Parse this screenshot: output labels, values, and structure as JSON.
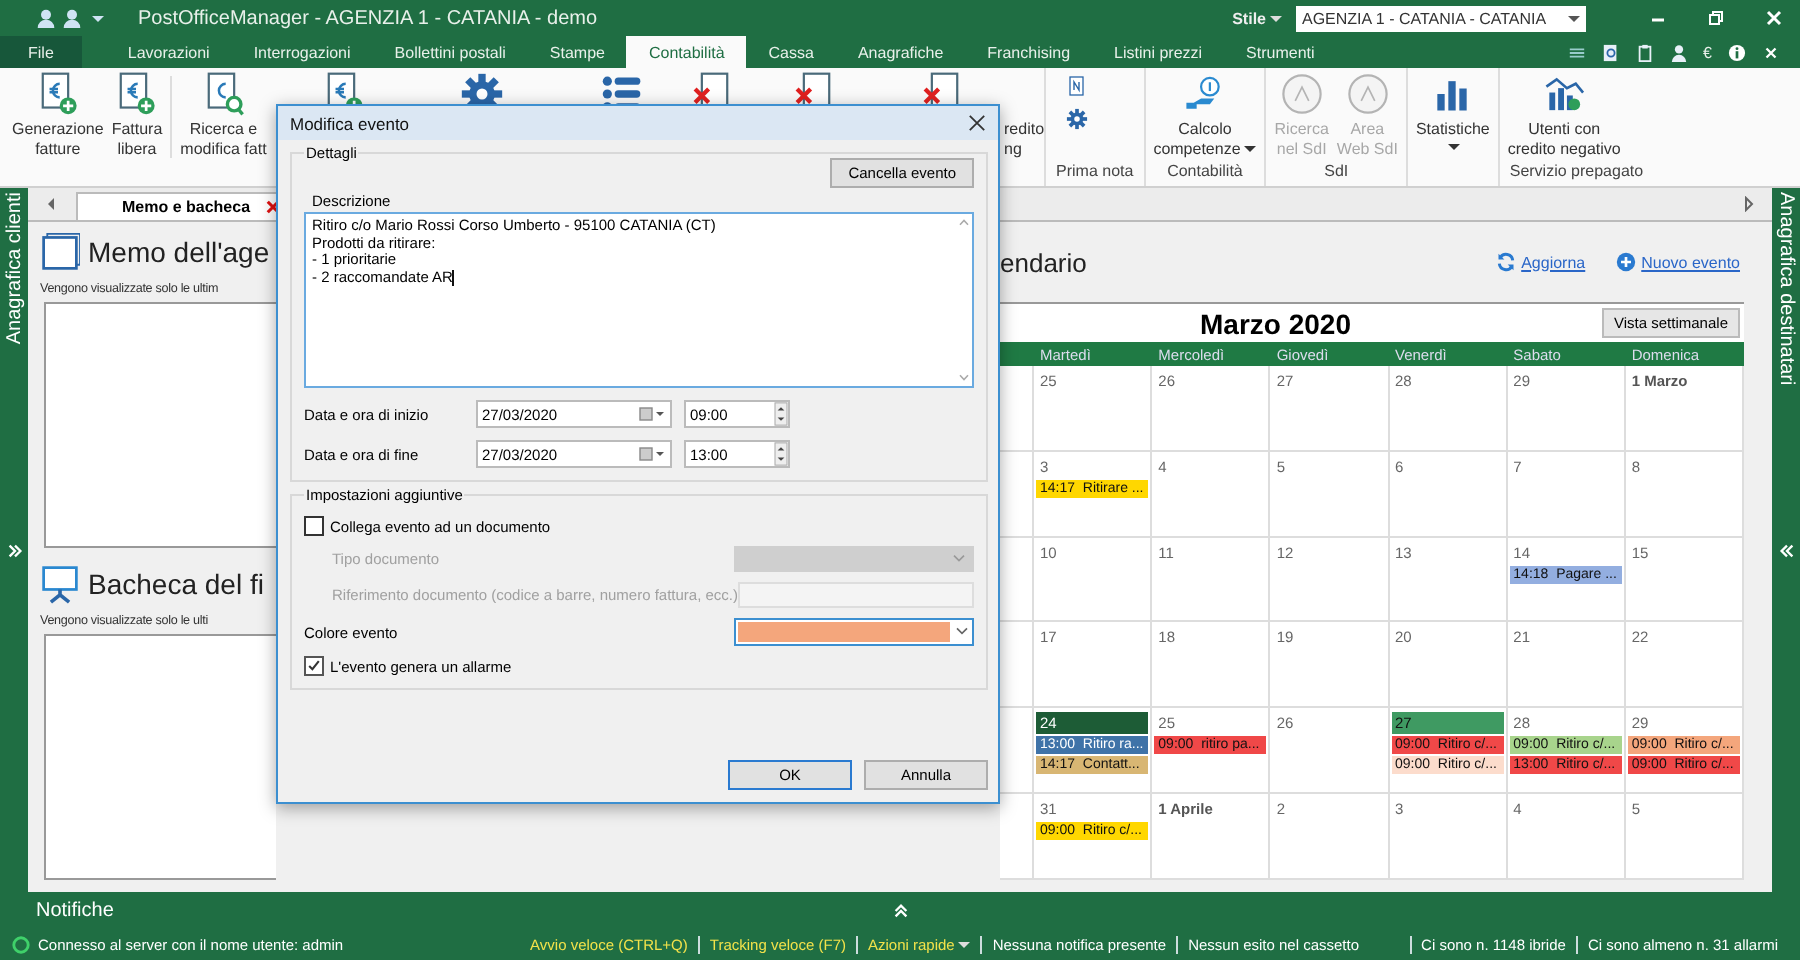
{
  "window": {
    "title": "PostOfficeManager - AGENZIA 1 - CATANIA - demo",
    "style_label": "Stile",
    "agency": "AGENZIA 1 - CATANIA - CATANIA"
  },
  "menu": [
    {
      "label": "File",
      "kind": "file",
      "selected": false
    },
    {
      "label": "Lavorazioni",
      "kind": "tab",
      "selected": false
    },
    {
      "label": "Interrogazioni",
      "kind": "tab",
      "selected": false
    },
    {
      "label": "Bollettini postali",
      "kind": "tab",
      "selected": false
    },
    {
      "label": "Stampe",
      "kind": "tab",
      "selected": false
    },
    {
      "label": "Contabilità",
      "kind": "tab",
      "selected": true
    },
    {
      "label": "Cassa",
      "kind": "tab",
      "selected": false
    },
    {
      "label": "Anagrafiche",
      "kind": "tab",
      "selected": false
    },
    {
      "label": "Franchising",
      "kind": "tab",
      "selected": false
    },
    {
      "label": "Listini prezzi",
      "kind": "tab",
      "selected": false
    },
    {
      "label": "Strumenti",
      "kind": "tab",
      "selected": false
    }
  ],
  "tray": {
    "currency": "€"
  },
  "ribbon": {
    "left_buttons": [
      {
        "lines": [
          "Generazione",
          "fatture"
        ]
      },
      {
        "lines": [
          "Fattura",
          "libera"
        ]
      },
      {
        "lines": [
          "Ricerca e",
          "modifica fatt"
        ]
      }
    ],
    "cut_label": [
      "redito",
      "ng"
    ],
    "groups": [
      {
        "label": "Prima nota"
      },
      {
        "label": "Contabilità",
        "buttons": [
          {
            "lines": [
              "Calcolo",
              "competenze"
            ],
            "dropdown": true
          }
        ]
      },
      {
        "label": "SdI",
        "buttons": [
          {
            "lines": [
              "Ricerca",
              "nel SdI"
            ],
            "disabled": true
          },
          {
            "lines": [
              "Area",
              "Web SdI"
            ],
            "disabled": true
          }
        ]
      },
      {
        "buttons": [
          {
            "lines": [
              "Statistiche"
            ],
            "dropdown": true
          }
        ]
      },
      {
        "label": "Servizio prepagato",
        "buttons": [
          {
            "lines": [
              "Utenti con",
              "credito negativo"
            ]
          }
        ]
      }
    ]
  },
  "sidebars": {
    "left": "Anagrafica clienti",
    "right": "Anagrafica destinatari"
  },
  "doc_tab": {
    "label": "Memo e bacheca",
    "selected": true
  },
  "memo": {
    "title": "Memo dell'age",
    "subtitle": "Vengono visualizzate solo le ultim"
  },
  "board": {
    "title": "Bacheca del fi",
    "subtitle": "Vengono visualizzate solo le ulti"
  },
  "calendar": {
    "heading": "endario",
    "refresh": "Aggiorna",
    "new_event": "Nuovo evento",
    "month": "Marzo 2020",
    "view_button": "Vista settimanale",
    "weekdays": [
      "Martedì",
      "Mercoledì",
      "Giovedì",
      "Venerdì",
      "Sabato",
      "Domenica"
    ],
    "weeks": [
      {
        "days": [
          {
            "label": "25"
          },
          {
            "label": "26"
          },
          {
            "label": "27"
          },
          {
            "label": "28"
          },
          {
            "label": "29"
          },
          {
            "label": "1 Marzo",
            "month_start": true
          }
        ]
      },
      {
        "days": [
          {
            "label": "3",
            "events": [
              {
                "time": "14:17",
                "title": "Ritirare ...",
                "color": "#ffd700"
              }
            ]
          },
          {
            "label": "4"
          },
          {
            "label": "5"
          },
          {
            "label": "6"
          },
          {
            "label": "7"
          },
          {
            "label": "8"
          }
        ]
      },
      {
        "days": [
          {
            "label": "10"
          },
          {
            "label": "11"
          },
          {
            "label": "12"
          },
          {
            "label": "13"
          },
          {
            "label": "14",
            "events": [
              {
                "time": "14:18",
                "title": "Pagare ...",
                "color": "#93aee0"
              }
            ]
          },
          {
            "label": "15"
          }
        ]
      },
      {
        "days": [
          {
            "label": "17"
          },
          {
            "label": "18"
          },
          {
            "label": "19"
          },
          {
            "label": "20"
          },
          {
            "label": "21"
          },
          {
            "label": "22"
          }
        ]
      },
      {
        "days": [
          {
            "label": "24",
            "color": "#1d5c36",
            "events": [
              {
                "time": "13:00",
                "title": "Ritiro ra...",
                "color": "#3f73a8"
              },
              {
                "time": "14:17",
                "title": "Contatt...",
                "color": "#d8b673"
              }
            ]
          },
          {
            "label": "25",
            "events": [
              {
                "time": "09:00",
                "title": "ritiro pa...",
                "color": "#f04848"
              }
            ]
          },
          {
            "label": "26"
          },
          {
            "label": "27",
            "color": "#3f9a62",
            "events": [
              {
                "time": "09:00",
                "title": "Ritiro c/...",
                "color": "#f04848"
              },
              {
                "time": "09:00",
                "title": "Ritiro c/...",
                "color": "#fcdccc"
              }
            ]
          },
          {
            "label": "28",
            "events": [
              {
                "time": "09:00",
                "title": "Ritiro c/...",
                "color": "#a8d48c"
              },
              {
                "time": "13:00",
                "title": "Ritiro c/...",
                "color": "#f04848"
              }
            ]
          },
          {
            "label": "29",
            "events": [
              {
                "time": "09:00",
                "title": "Ritiro c/...",
                "color": "#f4a67c"
              },
              {
                "time": "09:00",
                "title": "Ritiro c/...",
                "color": "#f04848"
              }
            ]
          }
        ]
      },
      {
        "days": [
          {
            "label": "31",
            "events": [
              {
                "time": "09:00",
                "title": "Ritiro c/...",
                "color": "#ffd700"
              }
            ]
          },
          {
            "label": "1 Aprile",
            "month_start": true
          },
          {
            "label": "2"
          },
          {
            "label": "3"
          },
          {
            "label": "4"
          },
          {
            "label": "5"
          }
        ]
      }
    ]
  },
  "dialog": {
    "title": "Modifica evento",
    "details_group": "Dettagli",
    "delete_button": "Cancella evento",
    "description_label": "Descrizione",
    "description_lines": [
      "Ritiro c/o Mario Rossi Corso Umberto - 95100 CATANIA (CT)",
      "Prodotti da ritirare:",
      "- 1 prioritarie",
      "- 2 raccomandate AR"
    ],
    "start_label": "Data e ora di inizio",
    "start_date": "27/03/2020",
    "start_time": "09:00",
    "end_label": "Data e ora di fine",
    "end_date": "27/03/2020",
    "end_time": "13:00",
    "extra_group": "Impostazioni aggiuntive",
    "link_document": {
      "label": "Collega evento ad un documento",
      "checked": false
    },
    "doc_type": {
      "label": "Tipo documento",
      "disabled": true
    },
    "doc_ref": {
      "label": "Riferimento documento (codice a barre, numero fattura, ecc.)",
      "disabled": true
    },
    "event_color": {
      "label": "Colore evento",
      "color": "#f4a67c"
    },
    "alarm": {
      "label": "L'evento genera un allarme",
      "checked": true
    },
    "ok": "OK",
    "cancel": "Annulla"
  },
  "notifications": {
    "label": "Notifiche"
  },
  "status_bar": [
    {
      "kind": "info",
      "text": "Connesso al server con il nome utente: admin"
    },
    {
      "kind": "action",
      "text": "Avvio veloce (CTRL+Q)"
    },
    {
      "kind": "action",
      "text": "Tracking veloce (F7)"
    },
    {
      "kind": "action",
      "text": "Azioni rapide",
      "dropdown": true
    },
    {
      "kind": "text",
      "text": "Nessuna notifica presente"
    },
    {
      "kind": "text",
      "text": "Nessun esito nel cassetto"
    },
    {
      "kind": "text",
      "text": "Ci sono n. 1148 ibride"
    },
    {
      "kind": "text",
      "text": "Ci sono almeno n. 31 allarmi"
    }
  ]
}
